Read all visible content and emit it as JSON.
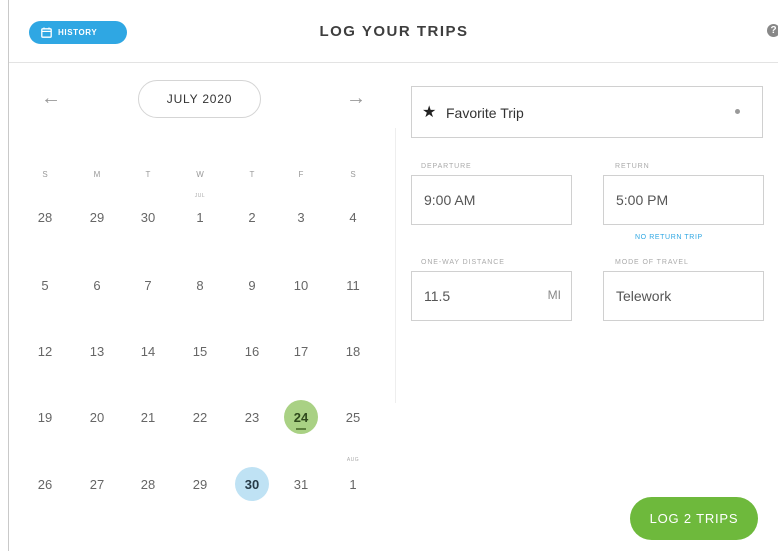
{
  "header": {
    "history_label": "HISTORY",
    "title": "LOG YOUR TRIPS",
    "help_glyph": "?"
  },
  "calendar": {
    "month_label": "JULY 2020",
    "prev_glyph": "←",
    "next_glyph": "→",
    "weekdays": [
      "S",
      "M",
      "T",
      "W",
      "T",
      "F",
      "S"
    ],
    "weeks": [
      [
        "28",
        "29",
        "30",
        "1",
        "2",
        "3",
        "4"
      ],
      [
        "5",
        "6",
        "7",
        "8",
        "9",
        "10",
        "11"
      ],
      [
        "12",
        "13",
        "14",
        "15",
        "16",
        "17",
        "18"
      ],
      [
        "19",
        "20",
        "21",
        "22",
        "23",
        "24",
        "25"
      ],
      [
        "26",
        "27",
        "28",
        "29",
        "30",
        "31",
        "1"
      ]
    ],
    "month_tags": {
      "jul": "JUL",
      "aug": "AUG"
    },
    "logged_day": "24",
    "selected_day": "30",
    "colors": {
      "logged": "#a9d184",
      "selected": "#bfe2f4"
    }
  },
  "trip": {
    "favorite_label": "Favorite Trip",
    "departure": {
      "label": "DEPARTURE",
      "value": "9:00 AM"
    },
    "return": {
      "label": "RETURN",
      "value": "5:00 PM"
    },
    "no_return_label": "NO RETURN TRIP",
    "distance": {
      "label": "ONE-WAY DISTANCE",
      "value": "11.5",
      "unit": "MI"
    },
    "mode": {
      "label": "MODE OF TRAVEL",
      "value": "Telework"
    }
  },
  "actions": {
    "log_label": "LOG 2 TRIPS"
  },
  "theme": {
    "accent_blue": "#2fa7e3",
    "accent_green": "#6eb93c"
  }
}
